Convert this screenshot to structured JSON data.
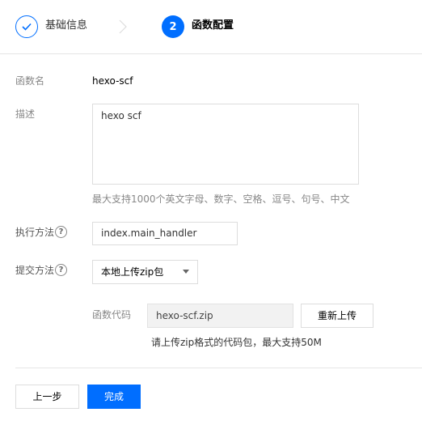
{
  "steps": [
    {
      "label": "基础信息",
      "status": "done",
      "icon": "check-icon"
    },
    {
      "number": "2",
      "label": "函数配置",
      "status": "active"
    }
  ],
  "form": {
    "name_label": "函数名",
    "name_value": "hexo-scf",
    "desc_label": "描述",
    "desc_value": "hexo scf",
    "desc_hint": "最大支持1000个英文字母、数字、空格、逗号、句号、中文",
    "handler_label": "执行方法",
    "handler_value": "index.main_handler",
    "submit_label": "提交方法",
    "submit_value": "本地上传zip包",
    "code_label": "函数代码",
    "code_file": "hexo-scf.zip",
    "reupload_label": "重新上传",
    "code_hint": "请上传zip格式的代码包，最大支持50M"
  },
  "footer": {
    "prev_label": "上一步",
    "finish_label": "完成"
  },
  "colors": {
    "primary": "#006eff",
    "muted": "#888888",
    "border": "#dddddd"
  }
}
